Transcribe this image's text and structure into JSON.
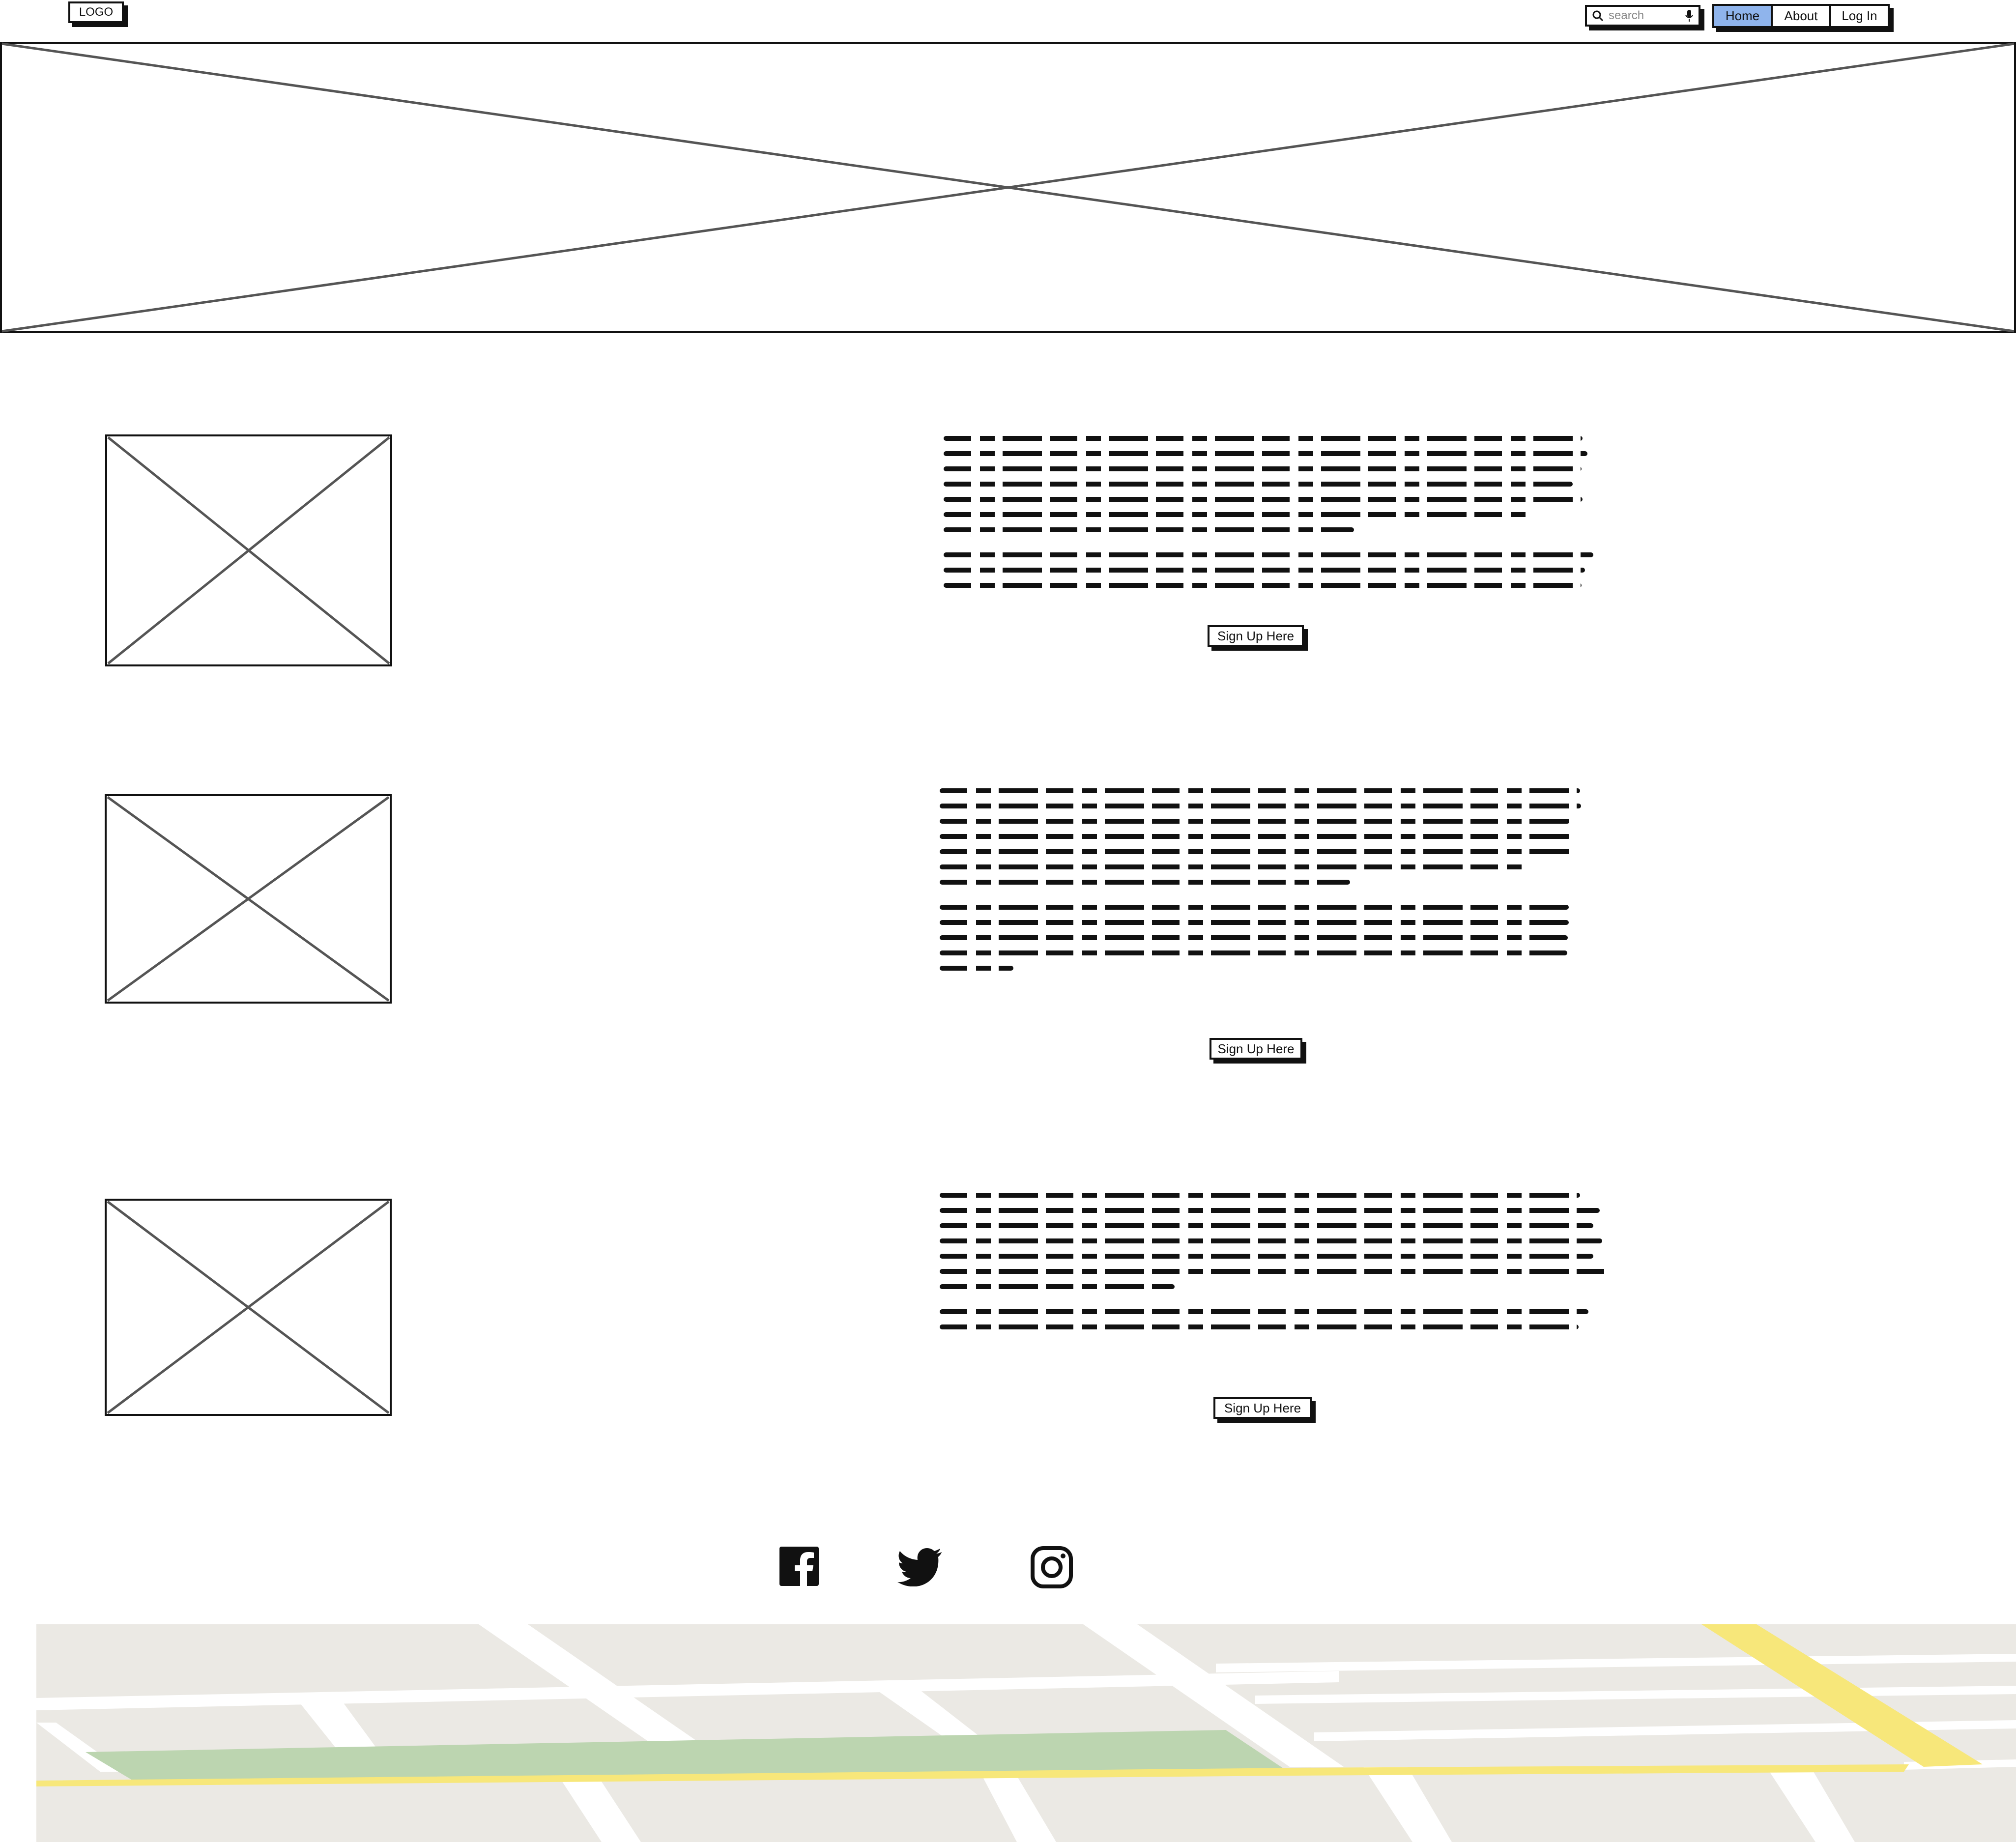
{
  "header": {
    "logo_text": "LOGO",
    "search_placeholder": "search",
    "nav": [
      {
        "label": "Home",
        "active": true
      },
      {
        "label": "About",
        "active": false
      },
      {
        "label": "Log In",
        "active": false
      }
    ],
    "active_color": "#8fb4ec"
  },
  "sections": [
    {
      "button_label": "Sign Up Here"
    },
    {
      "button_label": "Sign Up Here"
    },
    {
      "button_label": "Sign Up Here"
    }
  ],
  "footer": {
    "social_icons": [
      "facebook-icon",
      "twitter-icon",
      "instagram-icon"
    ]
  },
  "map": {
    "land_color": "#ebe9e4",
    "road_color": "#ffffff",
    "park_color": "#bcd5b0",
    "highway_color": "#f7e77a"
  }
}
